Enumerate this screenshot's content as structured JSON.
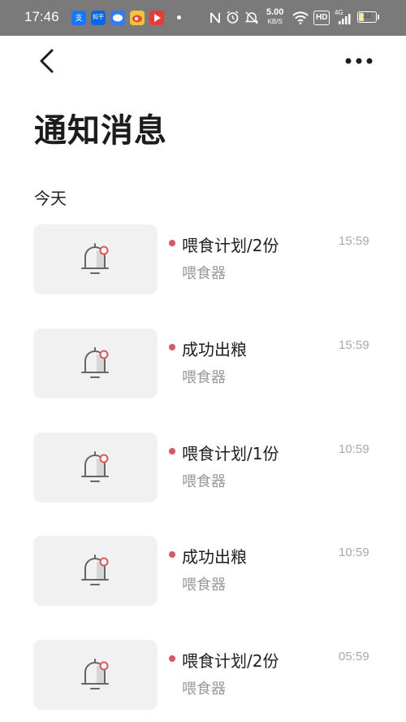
{
  "status_bar": {
    "time": "17:46",
    "speed_value": "5.00",
    "speed_unit": "KB/S",
    "hd_label": "HD",
    "network_label": "4G",
    "battery_level": "32",
    "app_icons": [
      {
        "name": "alipay-icon",
        "color": "#1677ff",
        "glyph": "支"
      },
      {
        "name": "zhihu-icon",
        "color": "#0a66e8",
        "glyph": "知乎"
      },
      {
        "name": "chat-bubble-icon",
        "color": "#2f7cf6",
        "glyph": "●"
      },
      {
        "name": "weibo-icon",
        "color": "#e64a3c",
        "glyph": "微"
      },
      {
        "name": "video-play-icon",
        "color": "#e83a3a",
        "glyph": "▶"
      }
    ]
  },
  "header": {
    "title": "通知消息"
  },
  "section": {
    "label": "今天"
  },
  "notifications": [
    {
      "title": "喂食计划/2份",
      "subtitle": "喂食器",
      "time": "15:59"
    },
    {
      "title": "成功出粮",
      "subtitle": "喂食器",
      "time": "15:59"
    },
    {
      "title": "喂食计划/1份",
      "subtitle": "喂食器",
      "time": "10:59"
    },
    {
      "title": "成功出粮",
      "subtitle": "喂食器",
      "time": "10:59"
    },
    {
      "title": "喂食计划/2份",
      "subtitle": "喂食器",
      "time": "05:59"
    }
  ],
  "colors": {
    "unread_dot": "#e05555",
    "thumb_bg": "#f1f1f1",
    "status_bar_bg": "#7a7a7a"
  }
}
